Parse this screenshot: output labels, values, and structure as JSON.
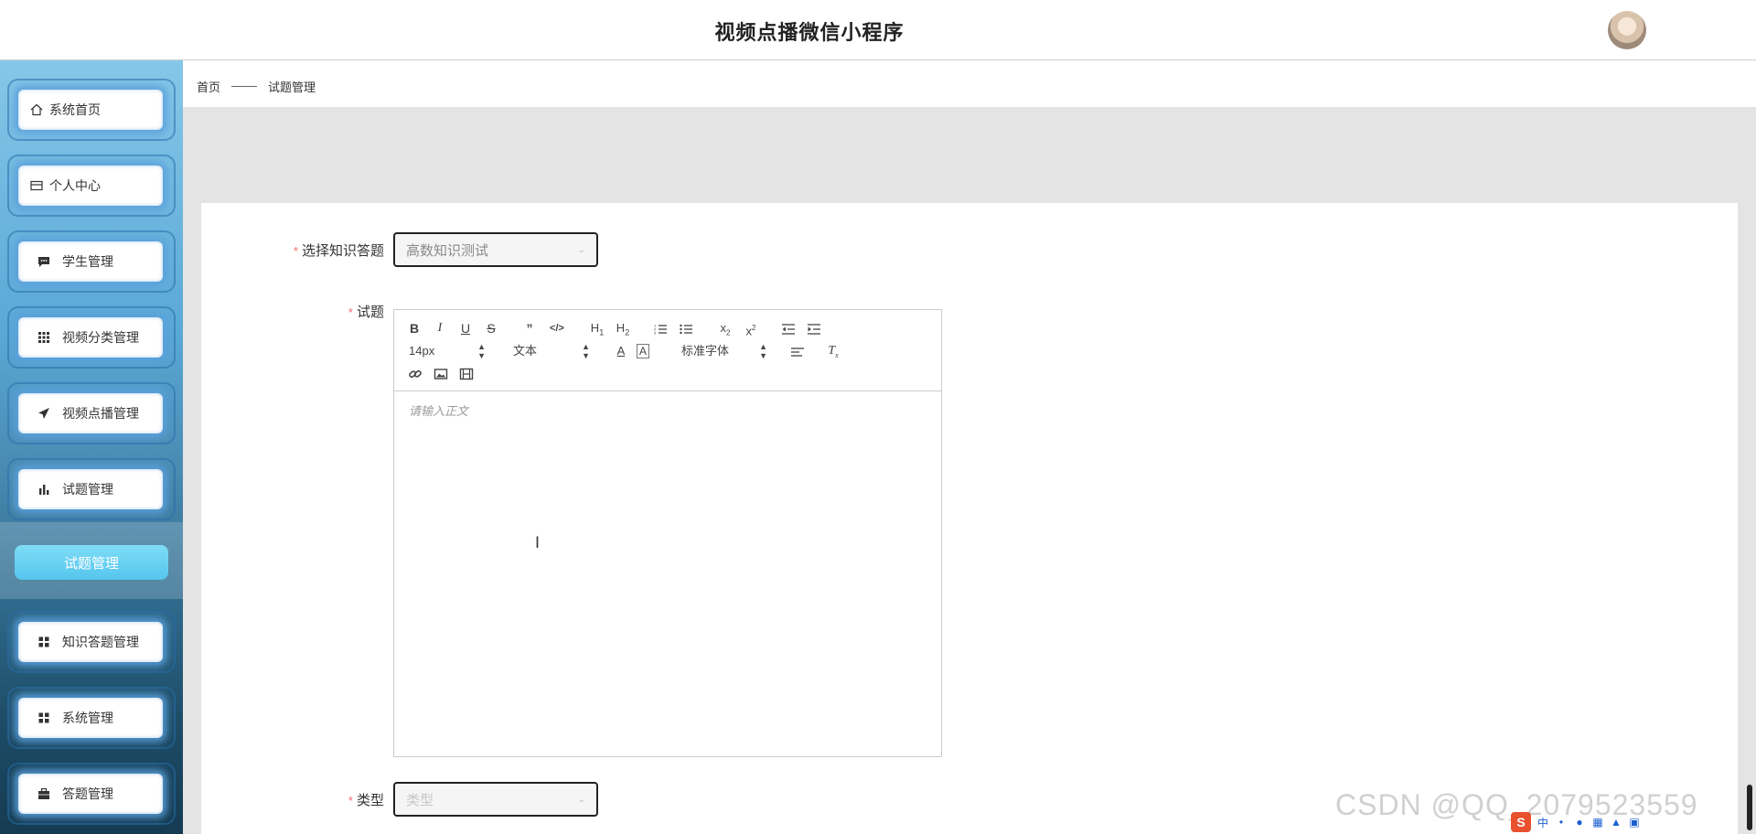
{
  "header": {
    "title": "视频点播微信小程序"
  },
  "sidebar": {
    "items": [
      {
        "label": "系统首页",
        "icon": "home-icon"
      },
      {
        "label": "个人中心",
        "icon": "card-icon"
      },
      {
        "label": "学生管理",
        "icon": "chat-icon"
      },
      {
        "label": "视频分类管理",
        "icon": "grid-icon"
      },
      {
        "label": "视频点播管理",
        "icon": "paper-plane-icon"
      },
      {
        "label": "试题管理",
        "icon": "bar-chart-icon"
      },
      {
        "label": "知识答题管理",
        "icon": "apps-icon"
      },
      {
        "label": "系统管理",
        "icon": "apps-icon"
      },
      {
        "label": "答题管理",
        "icon": "briefcase-icon"
      }
    ],
    "active_sub_item": "试题管理"
  },
  "breadcrumb": {
    "home": "首页",
    "current": "试题管理"
  },
  "form": {
    "knowledge_quiz": {
      "label": "选择知识答题",
      "value": "高数知识测试"
    },
    "question": {
      "label": "试题"
    },
    "type": {
      "label": "类型",
      "placeholder": "类型"
    }
  },
  "editor": {
    "font_size": "14px",
    "block_format": "文本",
    "font_family": "标准字体",
    "placeholder": "请输入正文",
    "buttons": [
      "B",
      "I",
      "U",
      "S",
      "”",
      "</>",
      "H1",
      "H2",
      "ordered-list",
      "bullet-list",
      "x₂",
      "x²",
      "outdent",
      "indent",
      "text-color",
      "background-color",
      "align",
      "clear-format",
      "link",
      "image",
      "video"
    ]
  },
  "watermark": "CSDN @QQ_2079523559",
  "colors": {
    "required": "#f56c6c",
    "active_sub": "#55c6ee",
    "sidebar_top": "#86c7e8",
    "sidebar_bottom": "#153b52"
  }
}
